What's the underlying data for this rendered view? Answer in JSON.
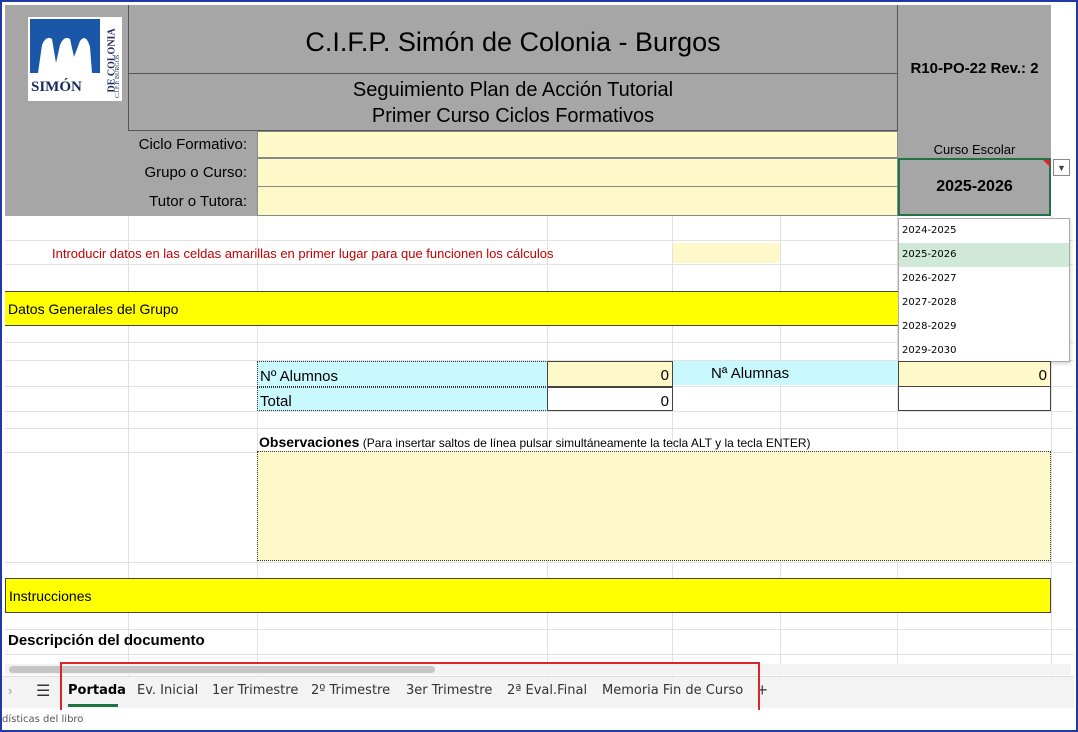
{
  "logo": {
    "text": "SIMÓN",
    "side_text": "DE COLONIA",
    "side_subtext": "C.I.F.P. BURGOS"
  },
  "header": {
    "school": "C.I.F.P. Simón de Colonia - Burgos",
    "subtitle_1": "Seguimiento Plan de Acción Tutorial",
    "subtitle_2": "Primer Curso Ciclos Formativos",
    "doc_code": "R10-PO-22 Rev.: 2"
  },
  "form": {
    "ciclo_label": "Ciclo Formativo:",
    "grupo_label": "Grupo o Curso:",
    "tutor_label": "Tutor o Tutora:",
    "curso_escolar_label": "Curso Escolar",
    "curso_escolar_value": "2025-2026"
  },
  "dropdown": {
    "options": [
      "2024-2025",
      "2025-2026",
      "2026-2027",
      "2027-2028",
      "2028-2029",
      "2029-2030"
    ],
    "selected": "2025-2026"
  },
  "notice": "Introducir datos en las celdas amarillas en primer lugar para que funcionen los cálculos",
  "sections": {
    "datos_generales": "Datos Generales del Grupo",
    "instrucciones": "Instrucciones",
    "descripcion": "Descripción del documento"
  },
  "stats": {
    "alumnos_label": "Nº Alumnos",
    "alumnos_value": "0",
    "alumnas_label": "Nª Alumnas",
    "alumnas_value": "0",
    "total_label": "Total",
    "total_value": "0"
  },
  "observaciones": {
    "label": "Observaciones",
    "hint": " (Para insertar saltos de línea pulsar simultáneamente la tecla ALT y la tecla ENTER)"
  },
  "tabs": [
    "Portada",
    "Ev. Inicial",
    "1er Trimestre",
    "2º Trimestre",
    "3er Trimestre",
    "2ª Eval.Final",
    "Memoria Fin de Curso"
  ],
  "active_tab": "Portada",
  "add_tab": "+",
  "status_bar": "dísticas del libro",
  "colors": {
    "yellow_cell": "#fff9c9",
    "yellow_bar": "#ffff00",
    "cyan_cell": "#c9f8ff",
    "header_gray": "#a6a6a6",
    "notice_red": "#c00000",
    "tab_highlight": "#d9262b"
  }
}
